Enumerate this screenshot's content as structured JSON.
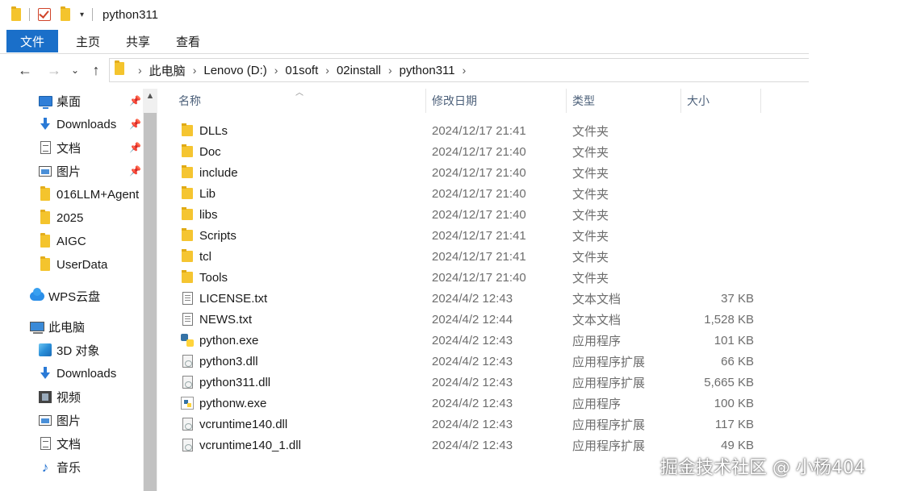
{
  "window": {
    "title": "python311"
  },
  "ribbon": {
    "tabs": [
      "文件",
      "主页",
      "共享",
      "查看"
    ]
  },
  "nav": {
    "back": "←",
    "forward": "→",
    "recent": "⌄",
    "up": "↑",
    "breadcrumb": [
      "此电脑",
      "Lenovo (D:)",
      "01soft",
      "02install",
      "python311"
    ]
  },
  "sidebar": {
    "items": [
      {
        "label": "桌面",
        "icon": "desktop-icon",
        "pinned": true
      },
      {
        "label": "Downloads",
        "icon": "download-icon",
        "pinned": true
      },
      {
        "label": "文档",
        "icon": "document-icon",
        "pinned": true
      },
      {
        "label": "图片",
        "icon": "picture-icon",
        "pinned": true
      },
      {
        "label": "016LLM+Agent",
        "icon": "folder-icon",
        "pinned": false
      },
      {
        "label": "2025",
        "icon": "folder-icon",
        "pinned": false
      },
      {
        "label": "AIGC",
        "icon": "folder-icon",
        "pinned": false
      },
      {
        "label": "UserData",
        "icon": "folder-icon",
        "pinned": false
      },
      {
        "label": "WPS云盘",
        "icon": "cloud-icon",
        "pinned": false
      },
      {
        "label": "此电脑",
        "icon": "computer-icon",
        "pinned": false
      },
      {
        "label": "3D 对象",
        "icon": "3d-objects-icon",
        "pinned": false
      },
      {
        "label": "Downloads",
        "icon": "download-icon",
        "pinned": false
      },
      {
        "label": "视频",
        "icon": "video-icon",
        "pinned": false
      },
      {
        "label": "图片",
        "icon": "picture-icon",
        "pinned": false
      },
      {
        "label": "文档",
        "icon": "document-icon",
        "pinned": false
      },
      {
        "label": "音乐",
        "icon": "music-icon",
        "pinned": false
      }
    ]
  },
  "columns": {
    "name": "名称",
    "modified": "修改日期",
    "type": "类型",
    "size": "大小"
  },
  "files": [
    {
      "name": "DLLs",
      "date": "2024/12/17 21:41",
      "type": "文件夹",
      "size": "",
      "icon": "folder"
    },
    {
      "name": "Doc",
      "date": "2024/12/17 21:40",
      "type": "文件夹",
      "size": "",
      "icon": "folder"
    },
    {
      "name": "include",
      "date": "2024/12/17 21:40",
      "type": "文件夹",
      "size": "",
      "icon": "folder"
    },
    {
      "name": "Lib",
      "date": "2024/12/17 21:40",
      "type": "文件夹",
      "size": "",
      "icon": "folder"
    },
    {
      "name": "libs",
      "date": "2024/12/17 21:40",
      "type": "文件夹",
      "size": "",
      "icon": "folder"
    },
    {
      "name": "Scripts",
      "date": "2024/12/17 21:41",
      "type": "文件夹",
      "size": "",
      "icon": "folder"
    },
    {
      "name": "tcl",
      "date": "2024/12/17 21:41",
      "type": "文件夹",
      "size": "",
      "icon": "folder"
    },
    {
      "name": "Tools",
      "date": "2024/12/17 21:40",
      "type": "文件夹",
      "size": "",
      "icon": "folder"
    },
    {
      "name": "LICENSE.txt",
      "date": "2024/4/2 12:43",
      "type": "文本文档",
      "size": "37 KB",
      "icon": "txt"
    },
    {
      "name": "NEWS.txt",
      "date": "2024/4/2 12:44",
      "type": "文本文档",
      "size": "1,528 KB",
      "icon": "txt"
    },
    {
      "name": "python.exe",
      "date": "2024/4/2 12:43",
      "type": "应用程序",
      "size": "101 KB",
      "icon": "exe"
    },
    {
      "name": "python3.dll",
      "date": "2024/4/2 12:43",
      "type": "应用程序扩展",
      "size": "66 KB",
      "icon": "dll"
    },
    {
      "name": "python311.dll",
      "date": "2024/4/2 12:43",
      "type": "应用程序扩展",
      "size": "5,665 KB",
      "icon": "dll"
    },
    {
      "name": "pythonw.exe",
      "date": "2024/4/2 12:43",
      "type": "应用程序",
      "size": "100 KB",
      "icon": "exew"
    },
    {
      "name": "vcruntime140.dll",
      "date": "2024/4/2 12:43",
      "type": "应用程序扩展",
      "size": "117 KB",
      "icon": "dll"
    },
    {
      "name": "vcruntime140_1.dll",
      "date": "2024/4/2 12:43",
      "type": "应用程序扩展",
      "size": "49 KB",
      "icon": "dll"
    }
  ],
  "watermark": "掘金技术社区 @ 小杨404"
}
